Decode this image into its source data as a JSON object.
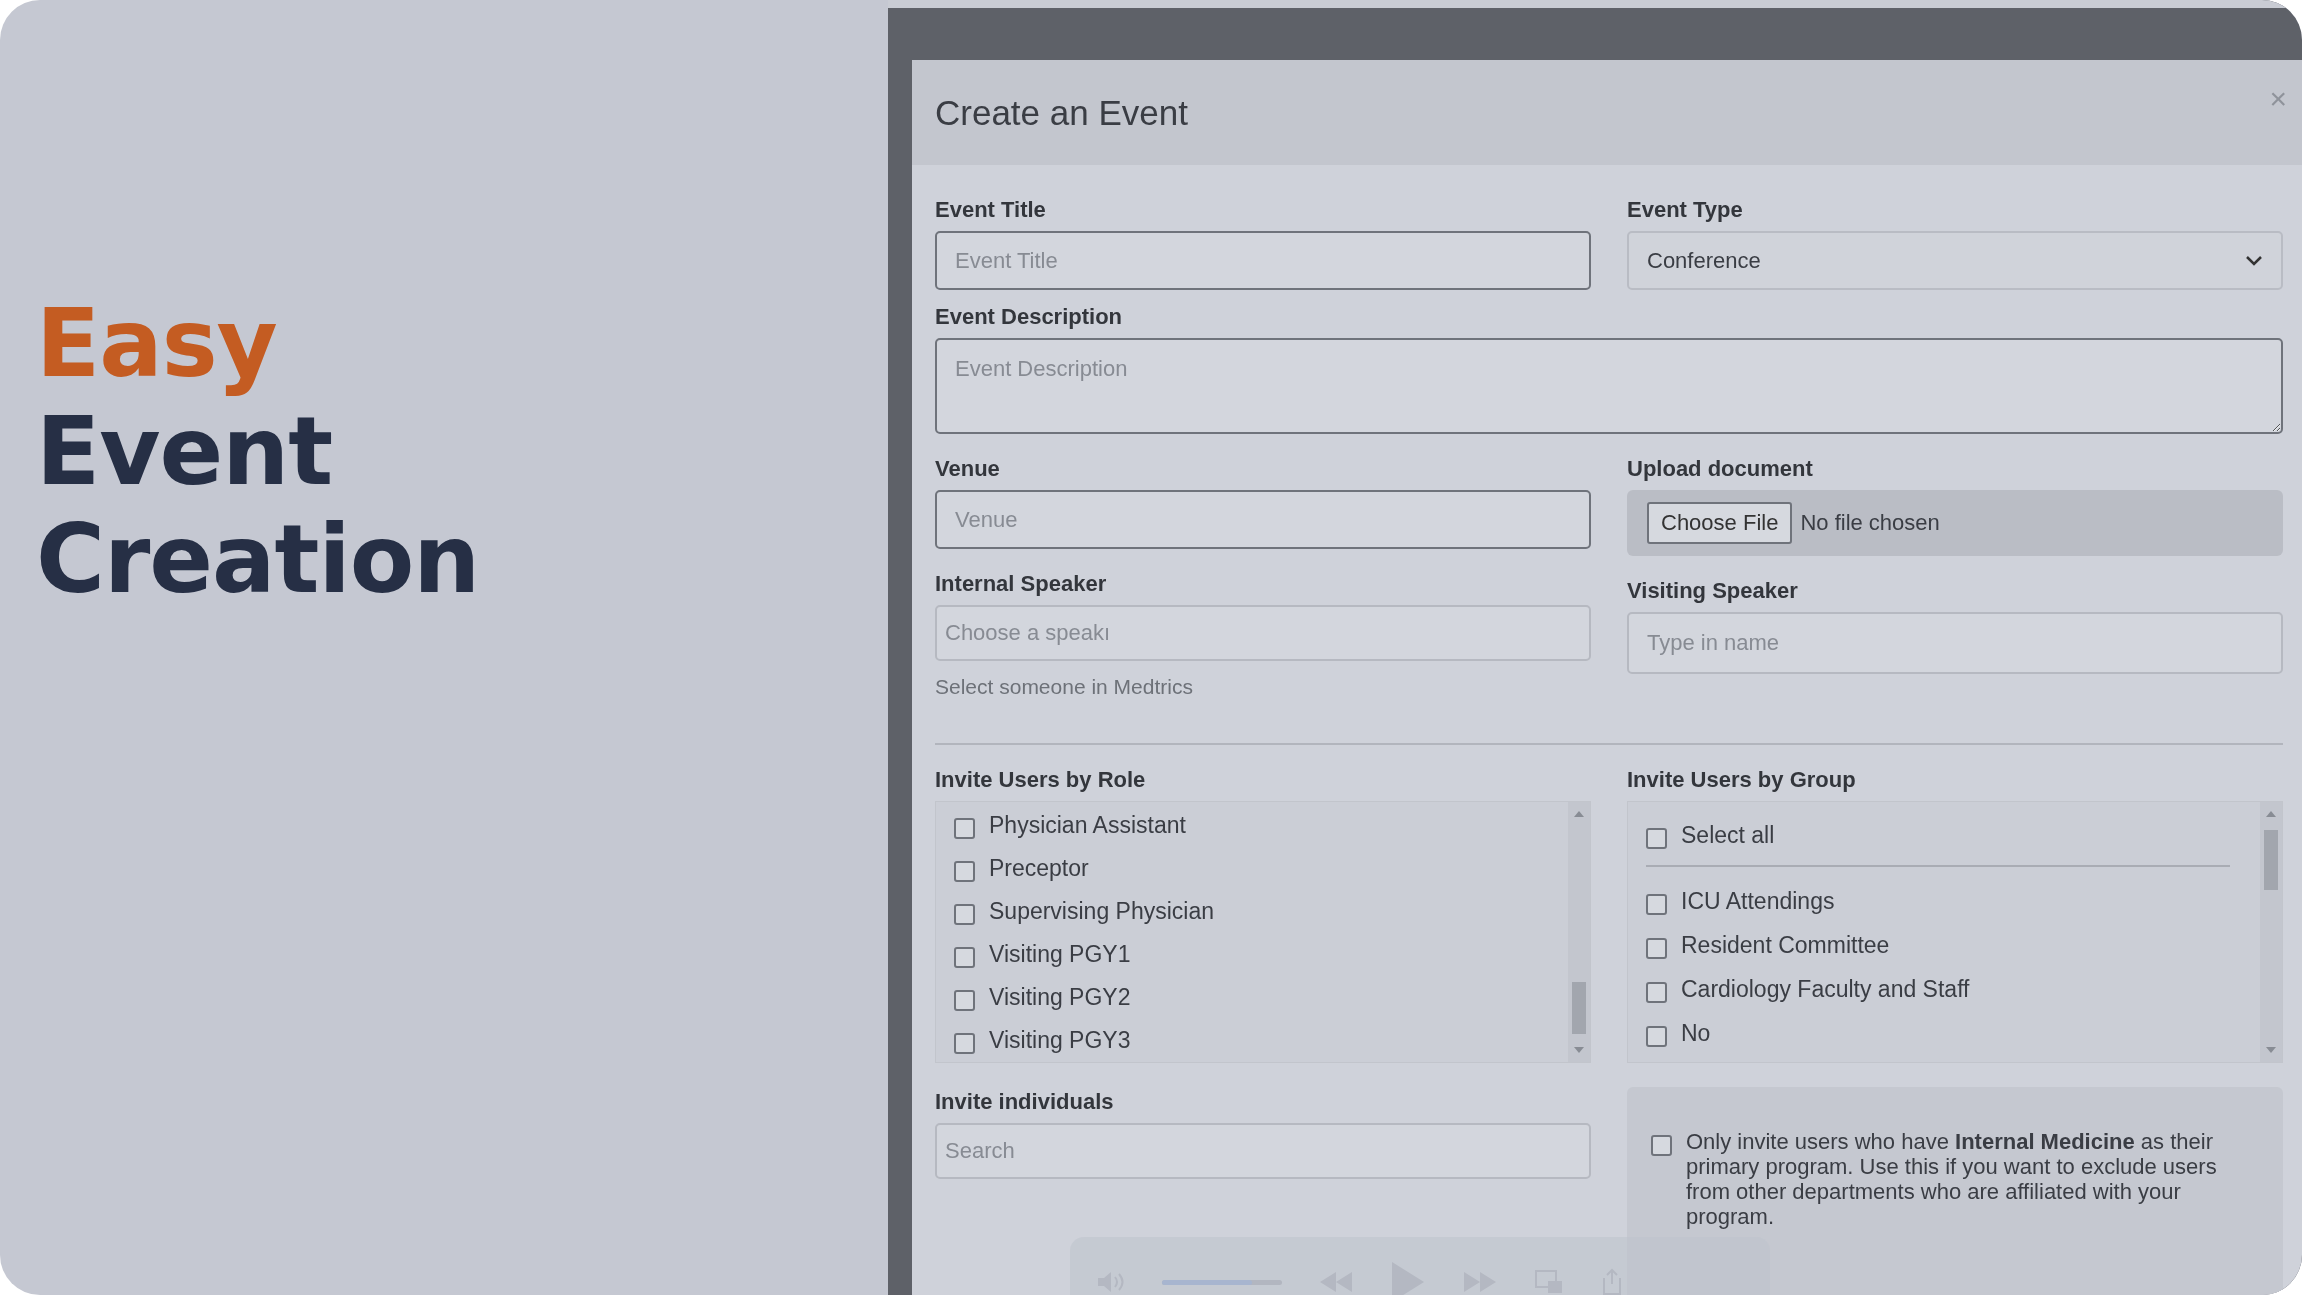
{
  "hero": {
    "lines": [
      {
        "text": "Easy",
        "accent": true
      },
      {
        "text": "Event",
        "accent": false
      },
      {
        "text": "Creation",
        "accent": false
      }
    ]
  },
  "dialog": {
    "title": "Create an Event",
    "close": "×",
    "event_title": {
      "label": "Event Title",
      "placeholder": "Event Title"
    },
    "event_type": {
      "label": "Event Type",
      "value": "Conference"
    },
    "event_description": {
      "label": "Event Description",
      "placeholder": "Event Description"
    },
    "venue": {
      "label": "Venue",
      "placeholder": "Venue"
    },
    "upload": {
      "label": "Upload document",
      "button": "Choose File",
      "status": "No file chosen"
    },
    "internal_speaker": {
      "label": "Internal Speaker",
      "placeholder": "Choose a speakı",
      "help": "Select someone in Medtrics"
    },
    "visiting_speaker": {
      "label": "Visiting Speaker",
      "placeholder": "Type in name"
    },
    "roles": {
      "label": "Invite Users by Role",
      "items": [
        {
          "text": "Physician Assistant",
          "checked": false
        },
        {
          "text": "Preceptor",
          "checked": false
        },
        {
          "text": "Supervising Physician",
          "checked": false
        },
        {
          "text": "Visiting PGY1",
          "checked": false
        },
        {
          "text": "Visiting PGY2",
          "checked": false
        },
        {
          "text": "Visiting PGY3",
          "checked": false
        }
      ]
    },
    "groups": {
      "label": "Invite Users by Group",
      "select_all": {
        "text": "Select all",
        "checked": false
      },
      "items": [
        {
          "text": "ICU Attendings",
          "checked": false
        },
        {
          "text": "Resident Committee",
          "checked": false
        },
        {
          "text": "Cardiology Faculty and Staff",
          "checked": false
        },
        {
          "text": "No",
          "checked": false
        }
      ]
    },
    "individuals": {
      "label": "Invite individuals",
      "placeholder": "Search"
    },
    "program_only": {
      "text": "Only invite users who have **Internal Medicine** as their primary program. Use this if you want to exclude users from other departments who are affiliated with your program.",
      "checked": false
    }
  },
  "player": {
    "volume": {
      "level": 0.75
    }
  }
}
